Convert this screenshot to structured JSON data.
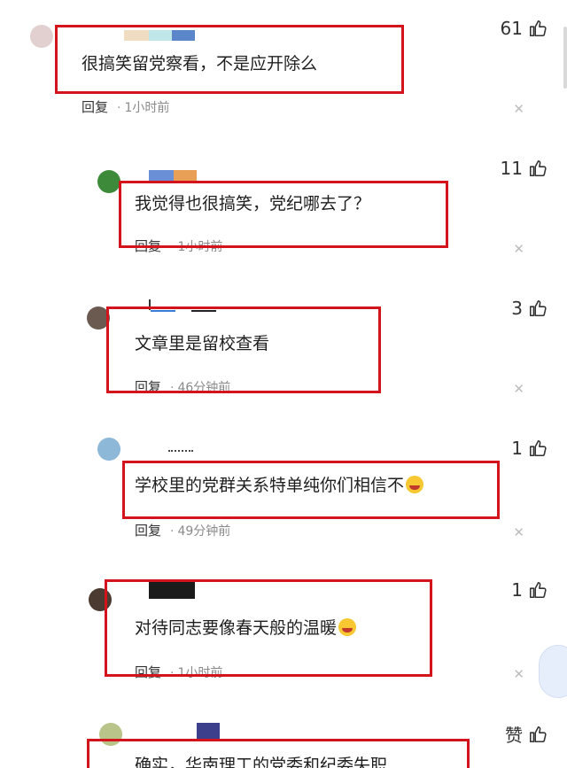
{
  "comments": [
    {
      "text": "很搞笑留党察看，不是应开除么",
      "reply": "回复",
      "time": "1小时前",
      "likes": "61"
    },
    {
      "text": "我觉得也很搞笑，党纪哪去了？",
      "reply": "回复",
      "time": "1小时前",
      "likes": "11"
    },
    {
      "text": "文章里是留校查看",
      "reply": "回复",
      "time": "46分钟前",
      "likes": "3"
    },
    {
      "text": "学校里的党群关系特单纯你们相信不",
      "reply": "回复",
      "time": "49分钟前",
      "likes": "1"
    },
    {
      "text": "对待同志要像春天般的温暖",
      "reply": "回复",
      "time": "1小时前",
      "likes": "1"
    },
    {
      "text": "确实，华南理工的党委和纪委失职",
      "likes": "赞"
    }
  ],
  "colors": {
    "highlight_box": "#d4141c",
    "meta_gray": "#8a8a8a"
  },
  "icons": {
    "like": "thumbs-up-icon",
    "close": "close-icon",
    "emoji_laugh": "laughing-emoji-icon",
    "emoji_grin": "grinning-emoji-icon"
  }
}
